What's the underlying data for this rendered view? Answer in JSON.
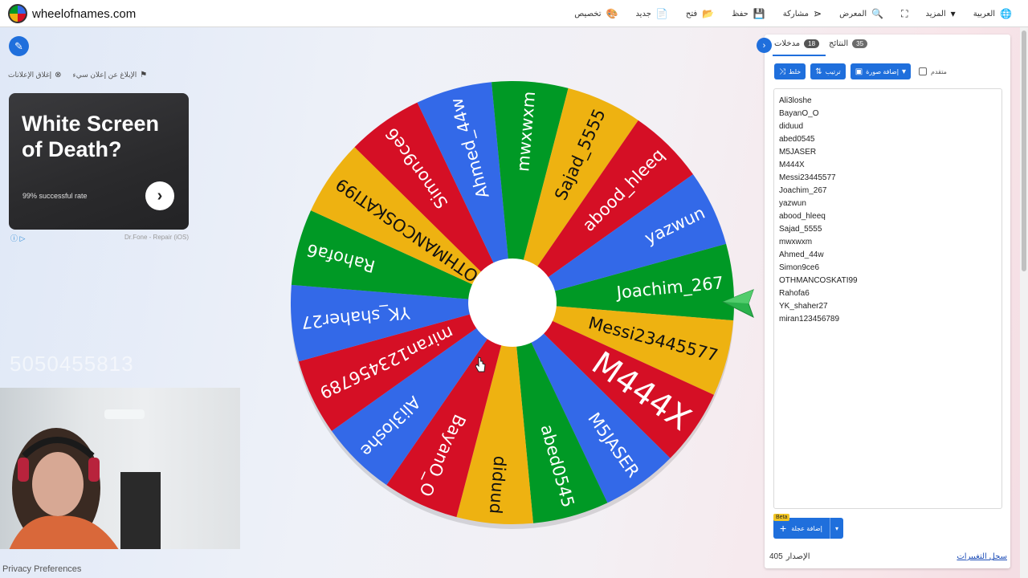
{
  "site": {
    "name": "wheelofnames.com"
  },
  "menu": [
    {
      "label": "العربية",
      "icon": "globe-icon",
      "name": "menu-language"
    },
    {
      "label": "المزيد",
      "icon": "caret-down-icon",
      "name": "menu-more"
    },
    {
      "label": "",
      "icon": "fullscreen-icon",
      "name": "menu-fullscreen"
    },
    {
      "label": "المعرض",
      "icon": "search-icon",
      "name": "menu-gallery"
    },
    {
      "label": "مشاركة",
      "icon": "share-icon",
      "name": "menu-share"
    },
    {
      "label": "حفظ",
      "icon": "save-icon",
      "name": "menu-save"
    },
    {
      "label": "فتح",
      "icon": "folder-icon",
      "name": "menu-open"
    },
    {
      "label": "جديد",
      "icon": "file-icon",
      "name": "menu-new"
    },
    {
      "label": "تخصيص",
      "icon": "palette-icon",
      "name": "menu-customize"
    }
  ],
  "ads": {
    "report_label": "الإبلاغ عن إعلان سيء",
    "close_label": "إغلاق الإعلانات",
    "title": "White Screen of Death?",
    "subtitle": "99% successful rate",
    "source": "Dr.Fone - Repair (iOS)"
  },
  "overlay_text": "5050455813",
  "footer": {
    "privacy": "Privacy Preferences"
  },
  "panel": {
    "tabs": {
      "entries_label": "مدخلات",
      "entries_count": "18",
      "results_label": "النتائج",
      "results_count": "35"
    },
    "toolbar": {
      "shuffle": "خلط",
      "sort": "ترتيب",
      "add_image": "إضافة صورة",
      "advanced": "متقدم"
    },
    "add_wheel": "إضافة عجلة",
    "beta": "Beta",
    "version_label": "الإصدار",
    "version_number": "405",
    "changelog": "سجل التغييرات"
  },
  "entries": [
    "Ali3loshe",
    "BayanO_O",
    "diduud",
    "abed0545",
    "M5JASER",
    "M444X",
    "Messi23445577",
    "Joachim_267",
    "yazwun",
    "abood_hleeq",
    "Sajad_5555",
    "mwxwxm",
    "Ahmed_44w",
    "Simon9ce6",
    "OTHMANCOSKATI99",
    "Rahofa6",
    "YK_shaher27",
    "miran123456789"
  ],
  "wheel": {
    "rotation_deg": -5.4,
    "colors": [
      "#3369e8",
      "#d50f25",
      "#eeb211",
      "#009925"
    ],
    "segments": [
      {
        "label": "Joachim_267",
        "color": "#009925"
      },
      {
        "label": "Messi23445577",
        "color": "#eeb211"
      },
      {
        "label": "M444X",
        "color": "#d50f25"
      },
      {
        "label": "M5JASER",
        "color": "#3369e8"
      },
      {
        "label": "abed0545",
        "color": "#009925"
      },
      {
        "label": "diduud",
        "color": "#eeb211"
      },
      {
        "label": "BayanO_O",
        "color": "#d50f25"
      },
      {
        "label": "Ali3loshe",
        "color": "#3369e8"
      },
      {
        "label": "miran123456789",
        "color": "#d50f25"
      },
      {
        "label": "YK_shaher27",
        "color": "#3369e8"
      },
      {
        "label": "Rahofa6",
        "color": "#009925"
      },
      {
        "label": "OTHMANCOSKATI99",
        "color": "#eeb211"
      },
      {
        "label": "Simon9ce6",
        "color": "#d50f25"
      },
      {
        "label": "Ahmed_44w",
        "color": "#3369e8"
      },
      {
        "label": "mwxwxm",
        "color": "#009925"
      },
      {
        "label": "Sajad_5555",
        "color": "#eeb211"
      },
      {
        "label": "abood_hleeq",
        "color": "#d50f25"
      },
      {
        "label": "yazwun",
        "color": "#3369e8"
      }
    ]
  }
}
